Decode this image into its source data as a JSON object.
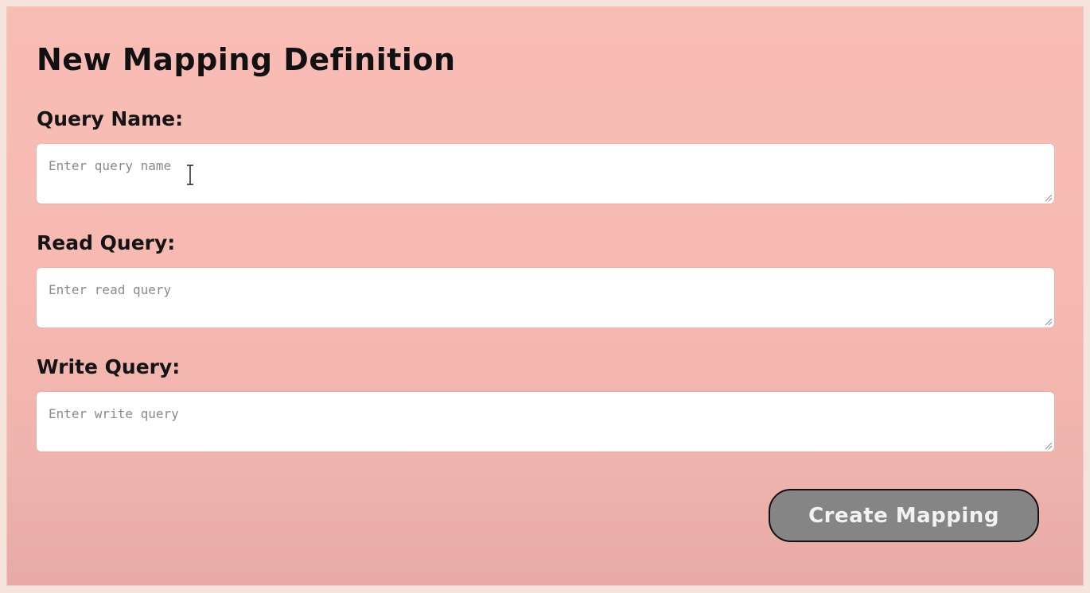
{
  "form": {
    "title": "New Mapping Definition",
    "fields": [
      {
        "label": "Query Name:",
        "placeholder": "Enter query name",
        "value": ""
      },
      {
        "label": "Read Query:",
        "placeholder": "Enter read query",
        "value": ""
      },
      {
        "label": "Write Query:",
        "placeholder": "Enter write query",
        "value": ""
      }
    ],
    "submit_label": "Create Mapping"
  },
  "colors": {
    "background": "#f8bdb5",
    "field_background": "#ffffff",
    "button_background": "#858585",
    "button_border": "#111111",
    "button_text": "#f2f2f2"
  },
  "icons": {
    "resize_handle": "resize-handle-icon",
    "text_cursor": "text-cursor-icon"
  }
}
